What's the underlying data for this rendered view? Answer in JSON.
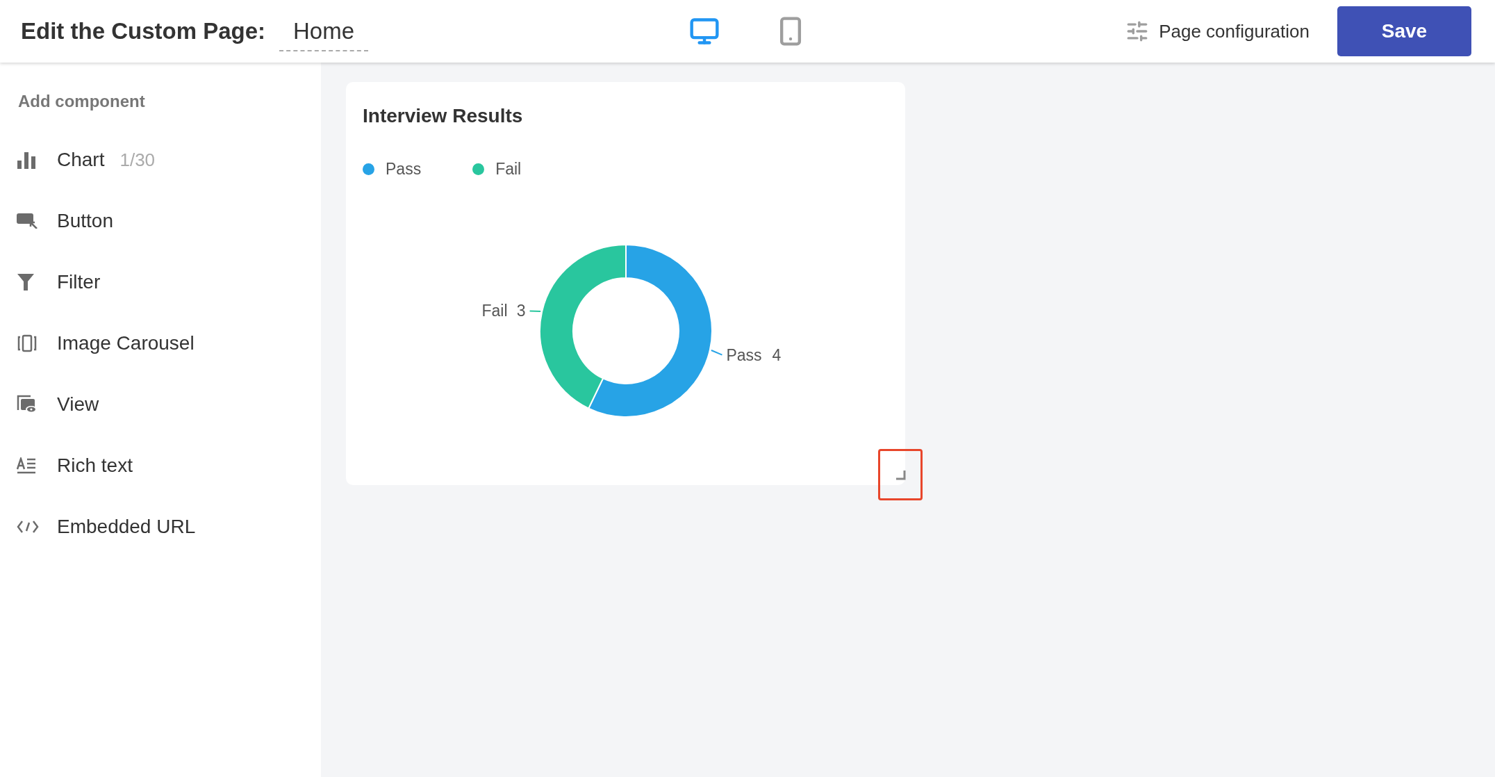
{
  "header": {
    "title": "Edit the Custom Page:",
    "page_name": "Home",
    "device_tabs": [
      {
        "kind": "desktop",
        "selected": true
      },
      {
        "kind": "mobile",
        "selected": false
      }
    ],
    "config_link": "Page configuration",
    "save_button": "Save"
  },
  "sidebar": {
    "heading": "Add component",
    "items": [
      {
        "kind": "chart",
        "label": "Chart",
        "count": "1/30"
      },
      {
        "kind": "button",
        "label": "Button"
      },
      {
        "kind": "filter",
        "label": "Filter"
      },
      {
        "kind": "carousel",
        "label": "Image Carousel"
      },
      {
        "kind": "view",
        "label": "View"
      },
      {
        "kind": "richtext",
        "label": "Rich text"
      },
      {
        "kind": "embed",
        "label": "Embedded URL"
      }
    ]
  },
  "card": {
    "title": "Interview Results",
    "legend": [
      {
        "label": "Pass",
        "color": "#27a3e6"
      },
      {
        "label": "Fail",
        "color": "#29c69e"
      }
    ],
    "chart_data": {
      "type": "donut",
      "categories": [
        "Pass",
        "Fail"
      ],
      "values": [
        4,
        3
      ],
      "data_labels": true
    }
  }
}
